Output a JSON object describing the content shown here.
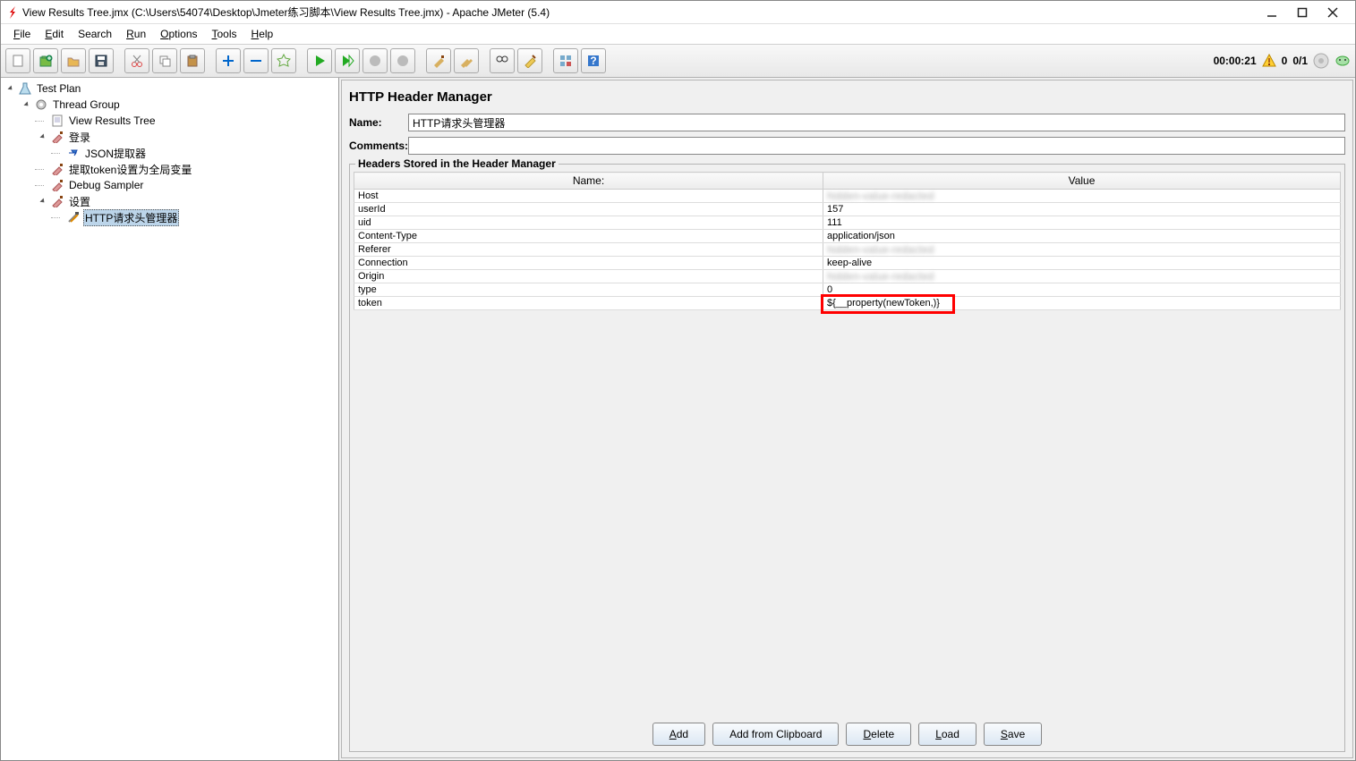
{
  "window": {
    "title": "View Results Tree.jmx (C:\\Users\\54074\\Desktop\\Jmeter练习脚本\\View Results Tree.jmx) - Apache JMeter (5.4)"
  },
  "menu": {
    "file": "File",
    "edit": "Edit",
    "search": "Search",
    "run": "Run",
    "options": "Options",
    "tools": "Tools",
    "help": "Help"
  },
  "status": {
    "timer": "00:00:21",
    "warn_count": "0",
    "active_threads": "0/1"
  },
  "tree": {
    "n0": "Test Plan",
    "n1": "Thread Group",
    "n2": "View Results Tree",
    "n3": "登录",
    "n4": "JSON提取器",
    "n5": "提取token设置为全局变量",
    "n6": "Debug Sampler",
    "n7": "设置",
    "n8": "HTTP请求头管理器"
  },
  "panel": {
    "title": "HTTP Header Manager",
    "name_label": "Name:",
    "name_value": "HTTP请求头管理器",
    "comments_label": "Comments:",
    "comments_value": "",
    "fieldset_legend": "Headers Stored in the Header Manager",
    "col_name": "Name:",
    "col_value": "Value",
    "headers": [
      {
        "name": "Host",
        "value": "",
        "blur": true
      },
      {
        "name": "userId",
        "value": "157"
      },
      {
        "name": "uid",
        "value": "111"
      },
      {
        "name": "Content-Type",
        "value": "application/json"
      },
      {
        "name": "Referer",
        "value": "",
        "blur": true
      },
      {
        "name": "Connection",
        "value": "keep-alive"
      },
      {
        "name": "Origin",
        "value": "",
        "blur": true
      },
      {
        "name": "type",
        "value": "0"
      },
      {
        "name": "token",
        "value": "${__property(newToken,)}",
        "highlight": true
      }
    ],
    "buttons": {
      "add": "Add",
      "add_clip": "Add from Clipboard",
      "delete": "Delete",
      "load": "Load",
      "save": "Save"
    }
  }
}
